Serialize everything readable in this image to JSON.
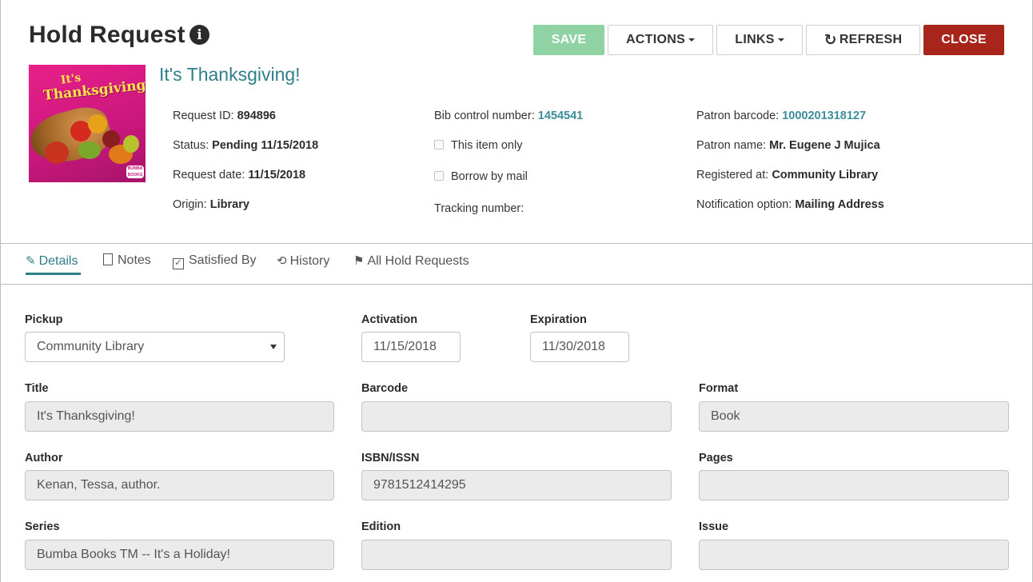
{
  "header": {
    "title": "Hold Request",
    "buttons": {
      "save": "SAVE",
      "actions": "ACTIONS",
      "links": "LINKS",
      "refresh": "REFRESH",
      "close": "CLOSE"
    }
  },
  "book": {
    "title": "It's Thanksgiving!",
    "cover": {
      "line1": "It's",
      "line2": "Thanksgiving!",
      "publisher": "BUMBA BOOKS"
    }
  },
  "meta": {
    "col1": [
      {
        "label": "Request ID: ",
        "value": "894896"
      },
      {
        "label": "Status: ",
        "value": "Pending 11/15/2018"
      },
      {
        "label": "Request date: ",
        "value": "11/15/2018"
      },
      {
        "label": "Origin: ",
        "value": "Library"
      }
    ],
    "col2": {
      "bib_label": "Bib control number: ",
      "bib_value": "1454541",
      "this_item_only": "This item only",
      "borrow_by_mail": "Borrow by mail",
      "tracking_label": "Tracking number:"
    },
    "col3": [
      {
        "label": "Patron barcode: ",
        "value": "1000201318127"
      },
      {
        "label": "Patron name: ",
        "value": "Mr. Eugene J Mujica"
      },
      {
        "label": "Registered at: ",
        "value": "Community Library"
      },
      {
        "label": "Notification option: ",
        "value": "Mailing Address"
      }
    ]
  },
  "tabs": {
    "details": "Details",
    "notes": "Notes",
    "satisfied_by": "Satisfied By",
    "history": "History",
    "all_hold_requests": "All Hold Requests"
  },
  "form": {
    "pickup": {
      "label": "Pickup",
      "value": "Community Library"
    },
    "activation": {
      "label": "Activation",
      "value": "11/15/2018"
    },
    "expiration": {
      "label": "Expiration",
      "value": "11/30/2018"
    },
    "title": {
      "label": "Title",
      "value": "It's Thanksgiving!"
    },
    "barcode": {
      "label": "Barcode",
      "value": ""
    },
    "format": {
      "label": "Format",
      "value": "Book"
    },
    "author": {
      "label": "Author",
      "value": "Kenan, Tessa, author."
    },
    "isbn": {
      "label": "ISBN/ISSN",
      "value": "9781512414295"
    },
    "pages": {
      "label": "Pages",
      "value": ""
    },
    "series": {
      "label": "Series",
      "value": "Bumba Books TM -- It's a Holiday!"
    },
    "edition": {
      "label": "Edition",
      "value": ""
    },
    "issue": {
      "label": "Issue",
      "value": ""
    }
  },
  "colors": {
    "accent": "#2f7f8a",
    "save": "#8fd3a4",
    "close": "#a8251c"
  }
}
